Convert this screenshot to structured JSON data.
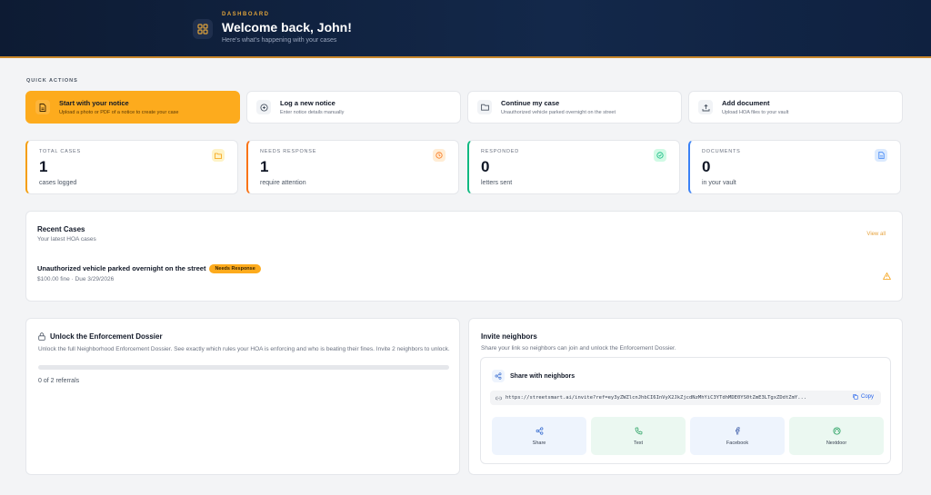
{
  "header": {
    "eyebrow": "DASHBOARD",
    "title": "Welcome back, John!",
    "subtitle": "Here's what's happening with your cases"
  },
  "quick_actions": {
    "label": "QUICK ACTIONS",
    "items": [
      {
        "title": "Start with your notice",
        "desc": "Upload a photo or PDF of a notice to create your case",
        "icon": "file-icon"
      },
      {
        "title": "Log a new notice",
        "desc": "Enter notice details manually",
        "icon": "plus-circle-icon"
      },
      {
        "title": "Continue my case",
        "desc": "Unauthorized vehicle parked overnight on the street",
        "icon": "folder-icon"
      },
      {
        "title": "Add document",
        "desc": "Upload HOA files to your vault",
        "icon": "upload-icon"
      }
    ]
  },
  "stats": [
    {
      "label": "TOTAL CASES",
      "value": "1",
      "sub": "cases logged",
      "color": "#f59e0b",
      "icon": "folder-icon"
    },
    {
      "label": "NEEDS RESPONSE",
      "value": "1",
      "sub": "require attention",
      "color": "#f97316",
      "icon": "clock-icon"
    },
    {
      "label": "RESPONDED",
      "value": "0",
      "sub": "letters sent",
      "color": "#10b981",
      "icon": "check-circle-icon"
    },
    {
      "label": "DOCUMENTS",
      "value": "0",
      "sub": "in your vault",
      "color": "#3b82f6",
      "icon": "document-icon"
    }
  ],
  "recent_cases": {
    "title": "Recent Cases",
    "subtitle": "Your latest HOA cases",
    "view_all": "View all",
    "case": {
      "title": "Unauthorized vehicle parked overnight on the street",
      "badge": "Needs Response",
      "meta": "$100.00 fine · Due 3/29/2026"
    }
  },
  "dossier": {
    "title": "Unlock the Enforcement Dossier",
    "desc": "Unlock the full Neighborhood Enforcement Dossier. See exactly which rules your HOA is enforcing and who is beating their fines. Invite 2 neighbors to unlock.",
    "progress": 0,
    "count": "0 of 2 referrals"
  },
  "invite": {
    "title": "Invite neighbors",
    "desc": "Share your link so neighbors can join and unlock the Enforcement Dossier.",
    "box_title": "Share with neighbors",
    "url": "https://streetsmart.ai/invite?ref=ey3yZWZlcnJhbCI6InVyX2JkZjcdNzMhYiC3YTdhMDE0YS0tZmE3LTgxZDdtZmY...",
    "copy": "Copy",
    "buttons": [
      {
        "label": "Share",
        "icon": "share-icon",
        "bg": "#eef4fd",
        "color": "#3b6fd1"
      },
      {
        "label": "Text",
        "icon": "phone-icon",
        "bg": "#ebf8f1",
        "color": "#1f9d5b"
      },
      {
        "label": "Facebook",
        "icon": "facebook-icon",
        "bg": "#eef4fd",
        "color": "#3b5ba8"
      },
      {
        "label": "Nextdoor",
        "icon": "nextdoor-icon",
        "bg": "#ebf8f1",
        "color": "#1f9d5b"
      }
    ]
  },
  "colors": {
    "accent": "#fdab1d",
    "header_bg": "#0d1b33"
  }
}
